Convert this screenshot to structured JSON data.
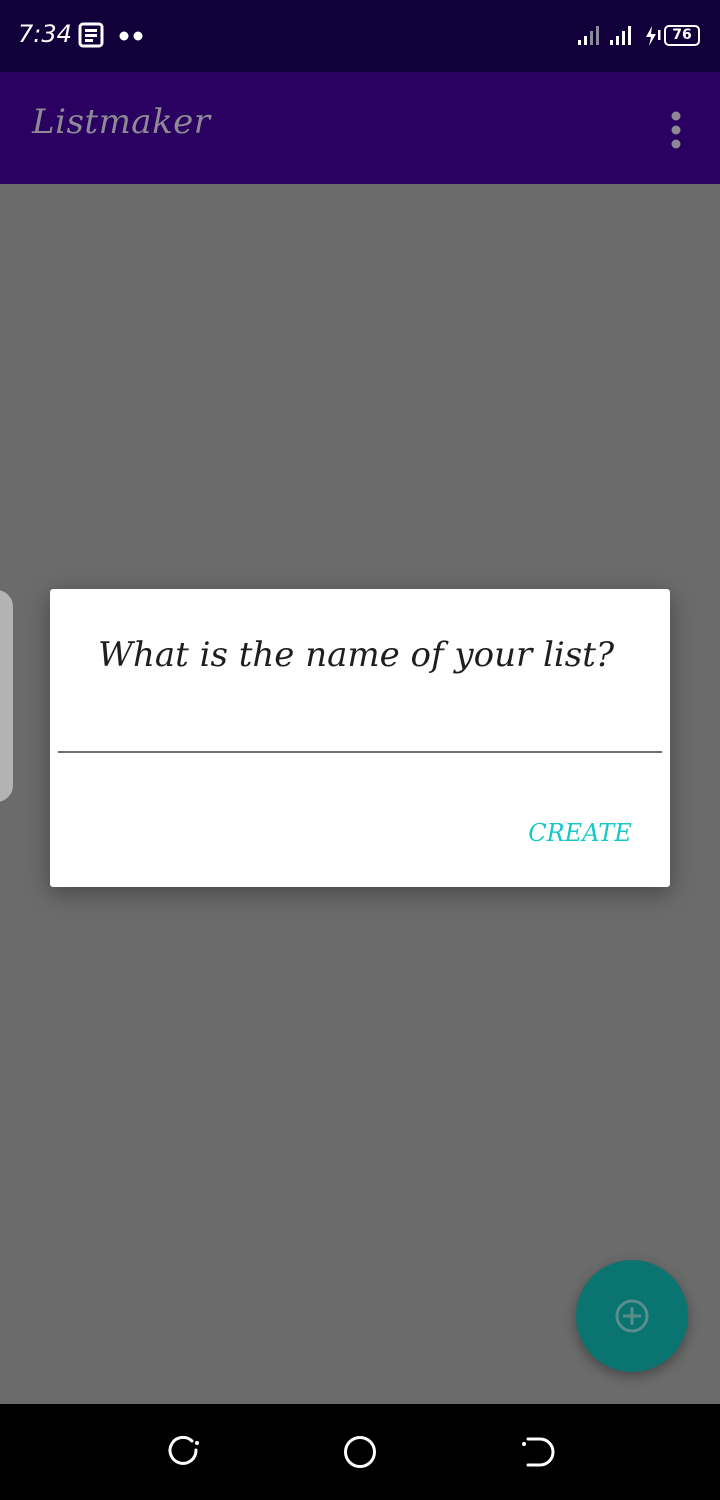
{
  "status_bar": {
    "time": "7:34",
    "battery_level": "76",
    "icons": [
      "news-icon",
      "notification-dots-icon",
      "signal-icon",
      "signal-icon",
      "charging-icon",
      "battery-icon"
    ]
  },
  "app_bar": {
    "title": "Listmaker",
    "overflow_icon": "more-vert-icon",
    "background_color": "#2a0060"
  },
  "dialog": {
    "title": "What is the name of your list?",
    "input_value": "",
    "create_label": "CREATE",
    "accent_color": "#18c8c8"
  },
  "fab": {
    "icon": "add-circle-icon",
    "color": "#0a7470"
  },
  "nav_bar": {
    "icons": [
      "back-icon",
      "home-icon",
      "recents-icon"
    ]
  }
}
